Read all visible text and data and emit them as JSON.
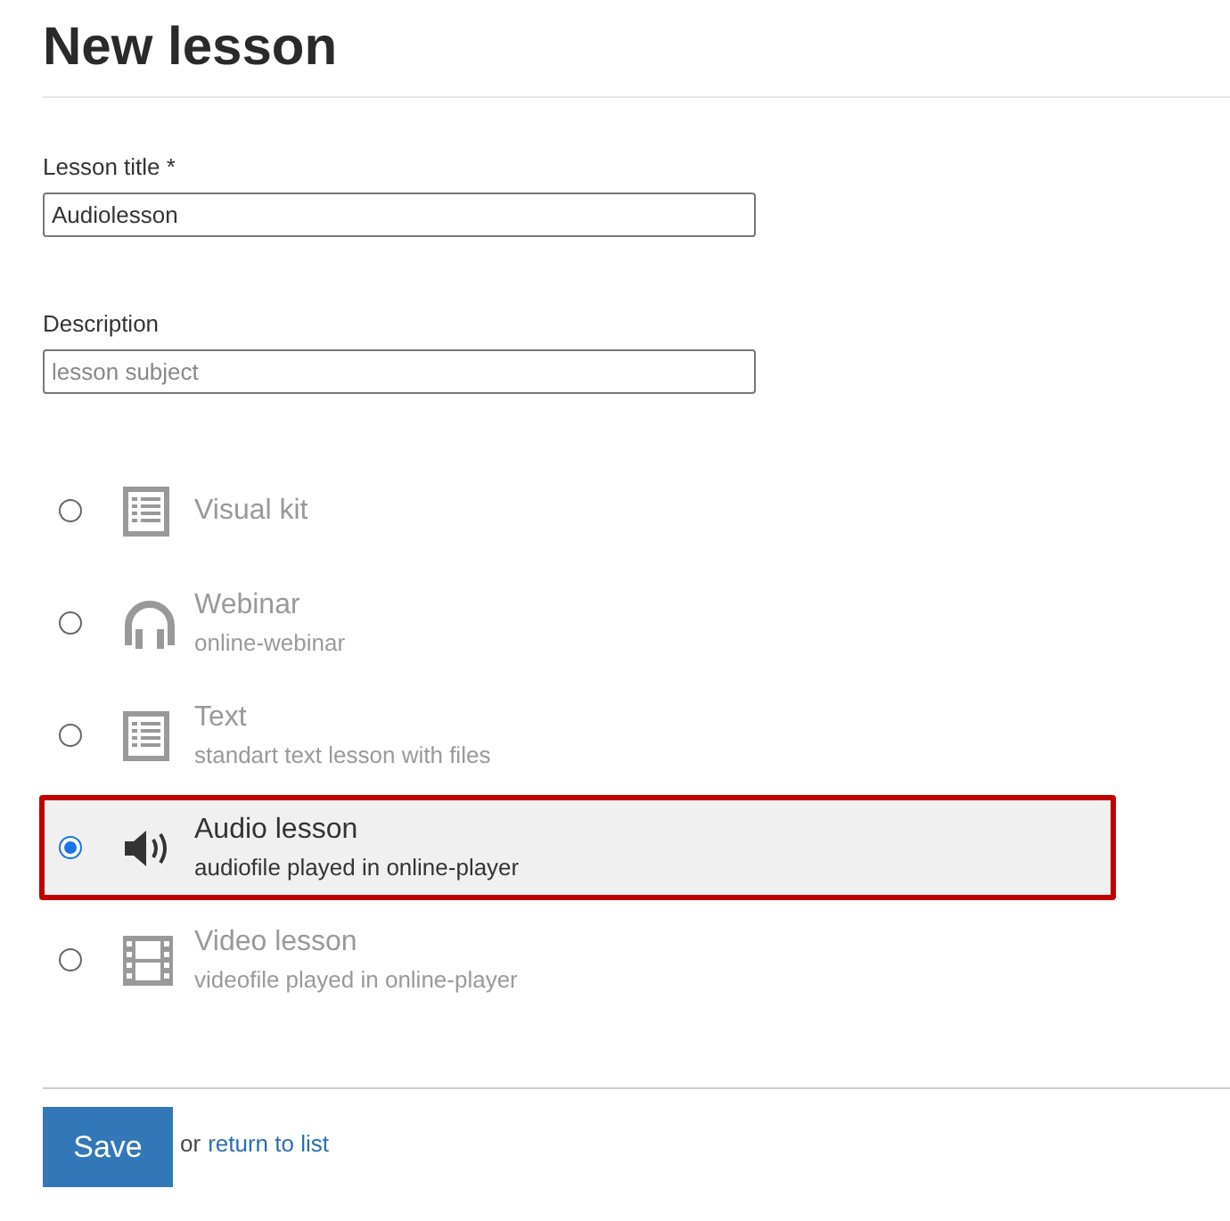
{
  "title": "New lesson",
  "fields": [
    {
      "label": "Lesson title *",
      "value": "Audiolesson"
    },
    {
      "label": "Description",
      "placeholder": "lesson subject"
    }
  ],
  "lesson_types": [
    {
      "kind": "list",
      "name": "Visual kit",
      "selected": false
    },
    {
      "kind": "headphones",
      "name": "Webinar",
      "description": "online-webinar",
      "selected": false
    },
    {
      "kind": "list",
      "name": "Text",
      "description": "standart text lesson with files",
      "selected": false
    },
    {
      "kind": "speaker",
      "name": "Audio lesson",
      "description": "audiofile played in online-player",
      "selected": true
    },
    {
      "kind": "film",
      "name": "Video lesson",
      "description": "videofile played in online-player",
      "selected": false
    }
  ],
  "save_button": "Save",
  "or_text": "or",
  "return_link": "return to list"
}
